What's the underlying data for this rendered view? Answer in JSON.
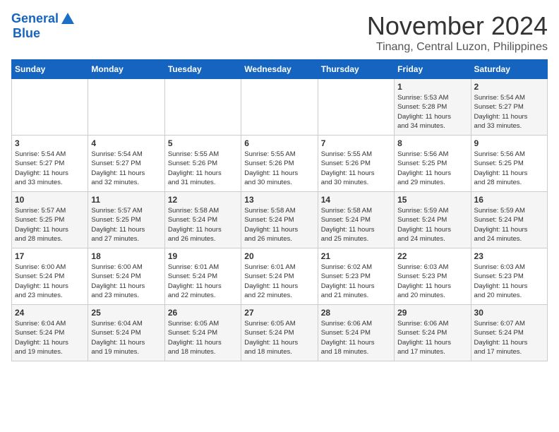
{
  "header": {
    "logo_line1": "General",
    "logo_line2": "Blue",
    "month": "November 2024",
    "location": "Tinang, Central Luzon, Philippines"
  },
  "weekdays": [
    "Sunday",
    "Monday",
    "Tuesday",
    "Wednesday",
    "Thursday",
    "Friday",
    "Saturday"
  ],
  "weeks": [
    [
      {
        "day": "",
        "info": ""
      },
      {
        "day": "",
        "info": ""
      },
      {
        "day": "",
        "info": ""
      },
      {
        "day": "",
        "info": ""
      },
      {
        "day": "",
        "info": ""
      },
      {
        "day": "1",
        "info": "Sunrise: 5:53 AM\nSunset: 5:28 PM\nDaylight: 11 hours\nand 34 minutes."
      },
      {
        "day": "2",
        "info": "Sunrise: 5:54 AM\nSunset: 5:27 PM\nDaylight: 11 hours\nand 33 minutes."
      }
    ],
    [
      {
        "day": "3",
        "info": "Sunrise: 5:54 AM\nSunset: 5:27 PM\nDaylight: 11 hours\nand 33 minutes."
      },
      {
        "day": "4",
        "info": "Sunrise: 5:54 AM\nSunset: 5:27 PM\nDaylight: 11 hours\nand 32 minutes."
      },
      {
        "day": "5",
        "info": "Sunrise: 5:55 AM\nSunset: 5:26 PM\nDaylight: 11 hours\nand 31 minutes."
      },
      {
        "day": "6",
        "info": "Sunrise: 5:55 AM\nSunset: 5:26 PM\nDaylight: 11 hours\nand 30 minutes."
      },
      {
        "day": "7",
        "info": "Sunrise: 5:55 AM\nSunset: 5:26 PM\nDaylight: 11 hours\nand 30 minutes."
      },
      {
        "day": "8",
        "info": "Sunrise: 5:56 AM\nSunset: 5:25 PM\nDaylight: 11 hours\nand 29 minutes."
      },
      {
        "day": "9",
        "info": "Sunrise: 5:56 AM\nSunset: 5:25 PM\nDaylight: 11 hours\nand 28 minutes."
      }
    ],
    [
      {
        "day": "10",
        "info": "Sunrise: 5:57 AM\nSunset: 5:25 PM\nDaylight: 11 hours\nand 28 minutes."
      },
      {
        "day": "11",
        "info": "Sunrise: 5:57 AM\nSunset: 5:25 PM\nDaylight: 11 hours\nand 27 minutes."
      },
      {
        "day": "12",
        "info": "Sunrise: 5:58 AM\nSunset: 5:24 PM\nDaylight: 11 hours\nand 26 minutes."
      },
      {
        "day": "13",
        "info": "Sunrise: 5:58 AM\nSunset: 5:24 PM\nDaylight: 11 hours\nand 26 minutes."
      },
      {
        "day": "14",
        "info": "Sunrise: 5:58 AM\nSunset: 5:24 PM\nDaylight: 11 hours\nand 25 minutes."
      },
      {
        "day": "15",
        "info": "Sunrise: 5:59 AM\nSunset: 5:24 PM\nDaylight: 11 hours\nand 24 minutes."
      },
      {
        "day": "16",
        "info": "Sunrise: 5:59 AM\nSunset: 5:24 PM\nDaylight: 11 hours\nand 24 minutes."
      }
    ],
    [
      {
        "day": "17",
        "info": "Sunrise: 6:00 AM\nSunset: 5:24 PM\nDaylight: 11 hours\nand 23 minutes."
      },
      {
        "day": "18",
        "info": "Sunrise: 6:00 AM\nSunset: 5:24 PM\nDaylight: 11 hours\nand 23 minutes."
      },
      {
        "day": "19",
        "info": "Sunrise: 6:01 AM\nSunset: 5:24 PM\nDaylight: 11 hours\nand 22 minutes."
      },
      {
        "day": "20",
        "info": "Sunrise: 6:01 AM\nSunset: 5:24 PM\nDaylight: 11 hours\nand 22 minutes."
      },
      {
        "day": "21",
        "info": "Sunrise: 6:02 AM\nSunset: 5:23 PM\nDaylight: 11 hours\nand 21 minutes."
      },
      {
        "day": "22",
        "info": "Sunrise: 6:03 AM\nSunset: 5:23 PM\nDaylight: 11 hours\nand 20 minutes."
      },
      {
        "day": "23",
        "info": "Sunrise: 6:03 AM\nSunset: 5:23 PM\nDaylight: 11 hours\nand 20 minutes."
      }
    ],
    [
      {
        "day": "24",
        "info": "Sunrise: 6:04 AM\nSunset: 5:24 PM\nDaylight: 11 hours\nand 19 minutes."
      },
      {
        "day": "25",
        "info": "Sunrise: 6:04 AM\nSunset: 5:24 PM\nDaylight: 11 hours\nand 19 minutes."
      },
      {
        "day": "26",
        "info": "Sunrise: 6:05 AM\nSunset: 5:24 PM\nDaylight: 11 hours\nand 18 minutes."
      },
      {
        "day": "27",
        "info": "Sunrise: 6:05 AM\nSunset: 5:24 PM\nDaylight: 11 hours\nand 18 minutes."
      },
      {
        "day": "28",
        "info": "Sunrise: 6:06 AM\nSunset: 5:24 PM\nDaylight: 11 hours\nand 18 minutes."
      },
      {
        "day": "29",
        "info": "Sunrise: 6:06 AM\nSunset: 5:24 PM\nDaylight: 11 hours\nand 17 minutes."
      },
      {
        "day": "30",
        "info": "Sunrise: 6:07 AM\nSunset: 5:24 PM\nDaylight: 11 hours\nand 17 minutes."
      }
    ]
  ]
}
